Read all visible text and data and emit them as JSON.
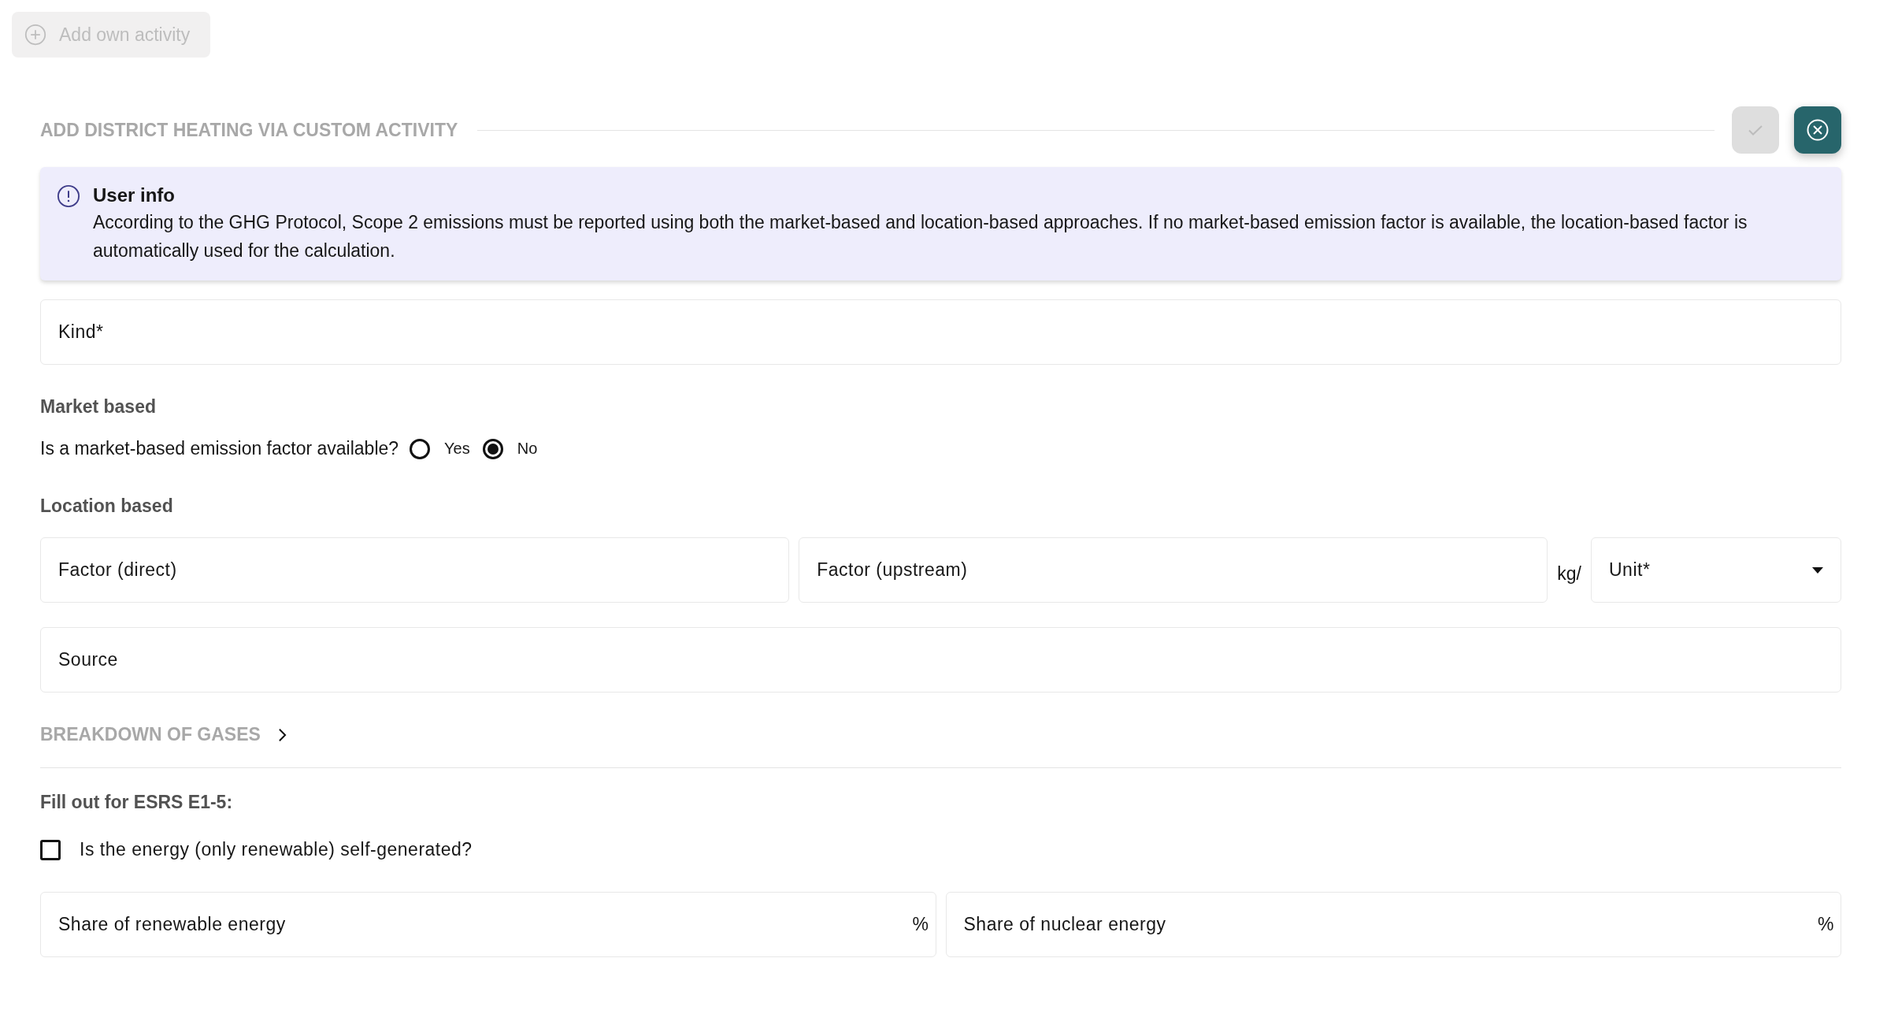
{
  "add_button": {
    "label": "Add own activity",
    "disabled": true
  },
  "section": {
    "title": "ADD DISTRICT HEATING VIA CUSTOM ACTIVITY",
    "confirm_disabled": true
  },
  "info": {
    "title": "User info",
    "text": "According to the GHG Protocol, Scope 2 emissions must be reported using both the market-based and location-based approaches. If no market-based emission factor is available, the location-based factor is automatically used for the calculation."
  },
  "kind_field": {
    "placeholder": "Kind*"
  },
  "market": {
    "heading": "Market based",
    "question": "Is a market-based emission factor available?",
    "options": [
      {
        "label": "Yes",
        "selected": false
      },
      {
        "label": "No",
        "selected": true
      }
    ]
  },
  "location": {
    "heading": "Location based",
    "factor_direct": {
      "placeholder": "Factor (direct)"
    },
    "factor_upstream": {
      "placeholder": "Factor (upstream)"
    },
    "unit_prefix": "kg/",
    "unit": {
      "placeholder": "Unit*"
    }
  },
  "source_field": {
    "placeholder": "Source"
  },
  "breakdown": {
    "title": "BREAKDOWN OF GASES",
    "expanded": false
  },
  "esrs": {
    "heading": "Fill out for ESRS E1-5:",
    "self_generated": {
      "label": "Is the energy (only renewable) self-generated?",
      "checked": false
    },
    "fields": [
      {
        "placeholder": "Share of renewable energy",
        "suffix": "%"
      },
      {
        "placeholder": "Share of nuclear energy",
        "suffix": "%"
      }
    ]
  }
}
